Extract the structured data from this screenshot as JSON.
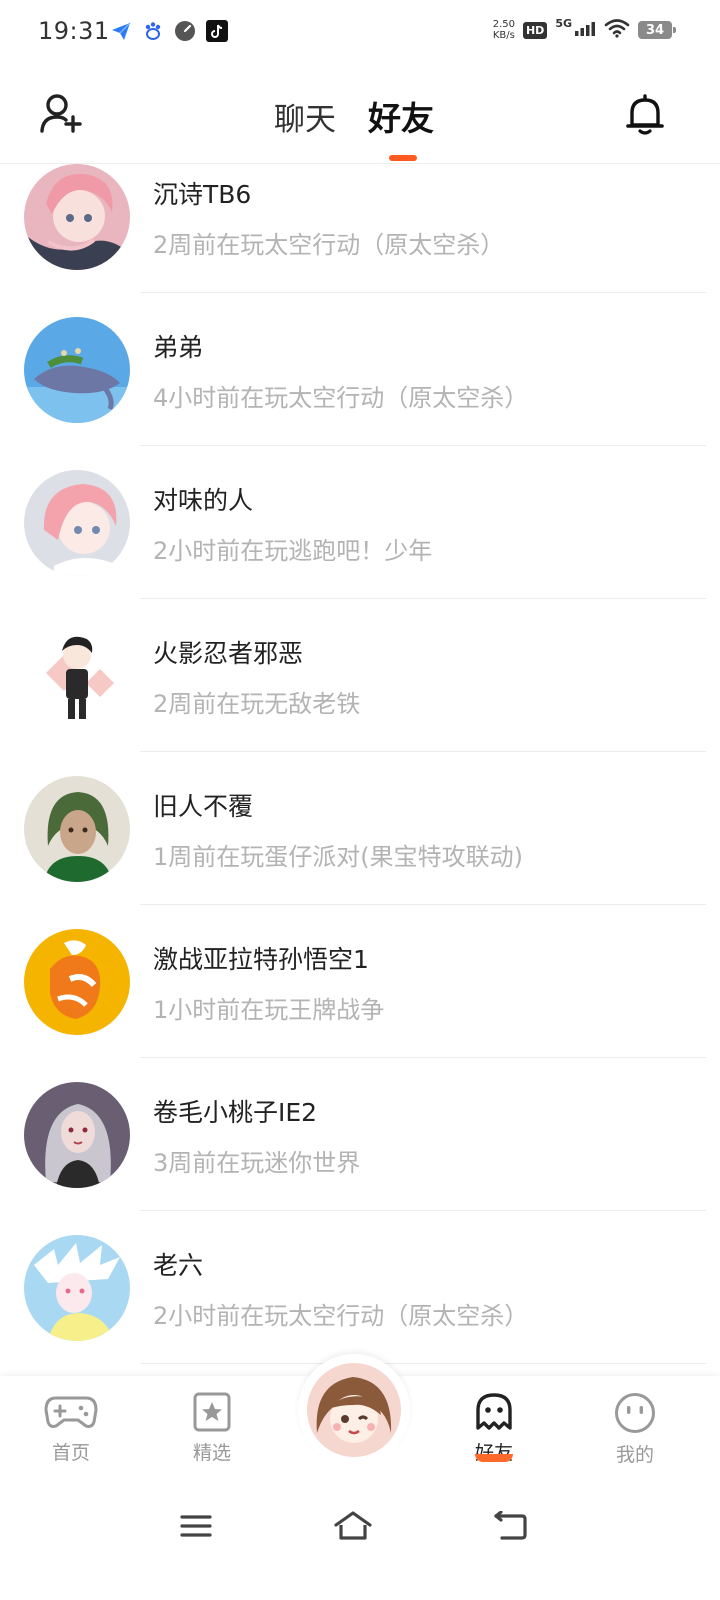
{
  "status_bar": {
    "time": "19:31",
    "net_speed_value": "2.50",
    "net_speed_unit": "KB/s",
    "hd": "HD",
    "network": "5G",
    "battery": "34",
    "app_icons": [
      "feishu-icon",
      "baidu-icon",
      "speedometer-icon",
      "tiktok-icon"
    ]
  },
  "header": {
    "tabs": [
      {
        "label": "聊天",
        "active": false
      },
      {
        "label": "好友",
        "active": true
      }
    ],
    "accent_color": "#ff5a1f"
  },
  "friends": [
    {
      "name": "沉诗TB6",
      "activity": "2周前在玩太空行动（原太空杀）"
    },
    {
      "name": "弟弟",
      "activity": "4小时前在玩太空行动（原太空杀）"
    },
    {
      "name": "对味的人",
      "activity": "2小时前在玩逃跑吧！少年"
    },
    {
      "name": "火影忍者邪恶",
      "activity": "2周前在玩无敌老铁"
    },
    {
      "name": "旧人不覆",
      "activity": "1周前在玩蛋仔派对(果宝特攻联动)"
    },
    {
      "name": "激战亚拉特孙悟空1",
      "activity": "1小时前在玩王牌战争"
    },
    {
      "name": "卷毛小桃子IE2",
      "activity": "3周前在玩迷你世界"
    },
    {
      "name": "老六",
      "activity": "2小时前在玩太空行动（原太空杀）"
    }
  ],
  "bottom_nav": {
    "items": [
      {
        "label": "首页",
        "icon": "gamepad-icon",
        "active": false
      },
      {
        "label": "精选",
        "icon": "star-card-icon",
        "active": false
      },
      {
        "label": "好友",
        "icon": "ghost-icon",
        "active": true
      },
      {
        "label": "我的",
        "icon": "smiley-face-icon",
        "active": false
      }
    ]
  },
  "colors": {
    "accent": "#ff5a1f",
    "text_primary": "#222222",
    "text_secondary": "#b3b3b3"
  }
}
